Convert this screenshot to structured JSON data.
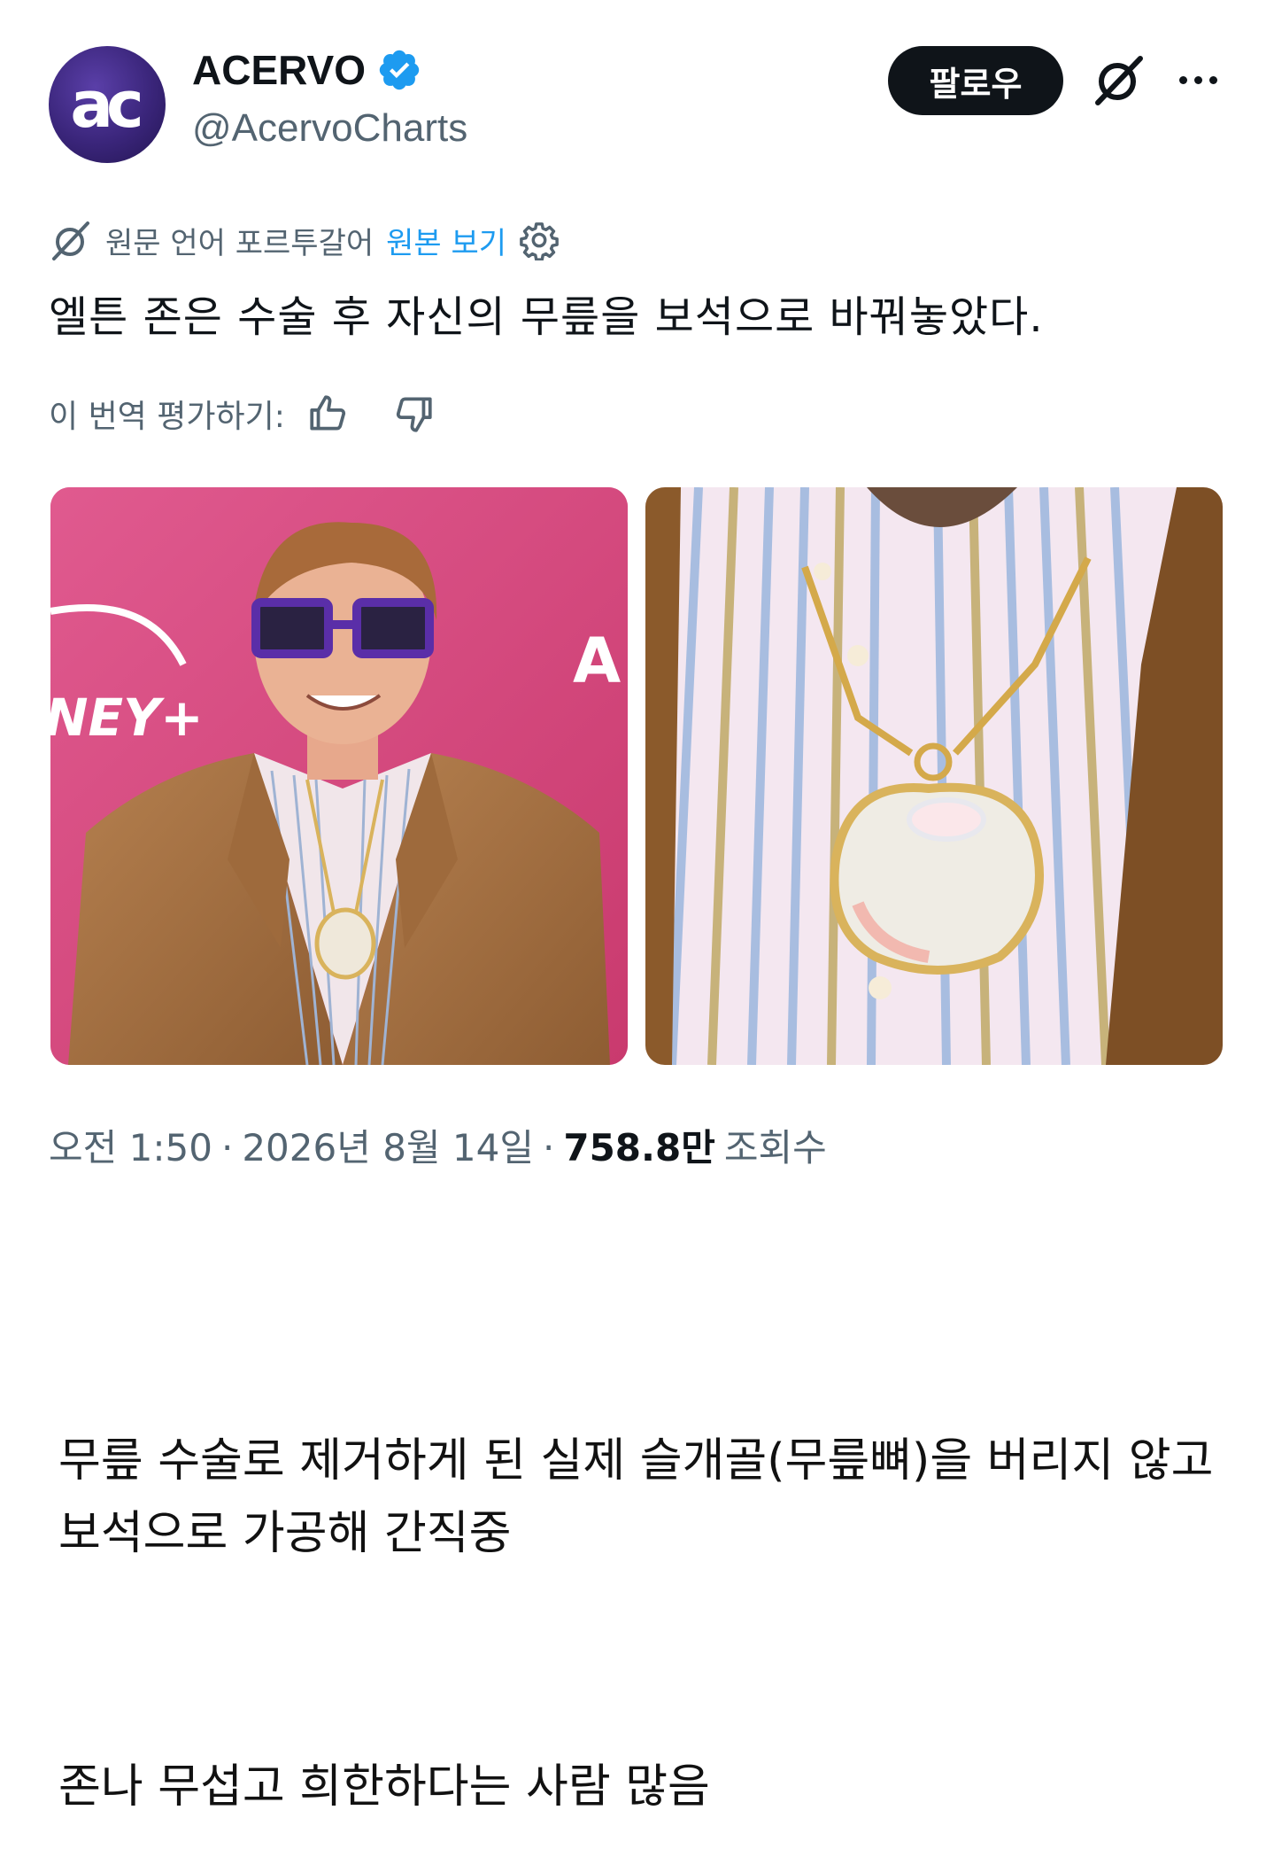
{
  "tweet": {
    "avatar_text": "ac",
    "display_name": "ACERVO",
    "handle": "@AcervoCharts",
    "follow_label": "팔로우",
    "icons": {
      "verified": "verified-badge-icon",
      "grok": "grok-icon",
      "more": "more-options-icon",
      "translate": "translate-icon",
      "settings": "gear-icon",
      "thumbs_up": "thumbs-up-icon",
      "thumbs_down": "thumbs-down-icon"
    },
    "translation": {
      "source_label": "원문 언어 포르투갈어",
      "view_original_label": "원본 보기"
    },
    "text": "엘튼 존은 수술 후 자신의 무릎을 보석으로 바꿔놓았다.",
    "rate_label": "이 번역 평가하기:",
    "meta": {
      "time": "오전 1:50",
      "sep1": "·",
      "date": "2026년 8월 14일",
      "sep2": "·",
      "views_count": "758.8만",
      "views_label": "조회수"
    }
  },
  "images": {
    "left_backdrop_text_1": "NEY+",
    "left_backdrop_text_2": "A"
  },
  "comments": [
    "무릎 수술로 제거하게 된 실제 슬개골(무릎뼈)을 버리지 않고 보석으로 가공해 간직중",
    "존나 무섭고 희한하다는 사람 많음"
  ],
  "colors": {
    "verified": "#1d9bf0",
    "link": "#1d9bf0",
    "secondary_text": "#536471",
    "primary_text": "#0f1419",
    "follow_bg": "#0f1419"
  }
}
